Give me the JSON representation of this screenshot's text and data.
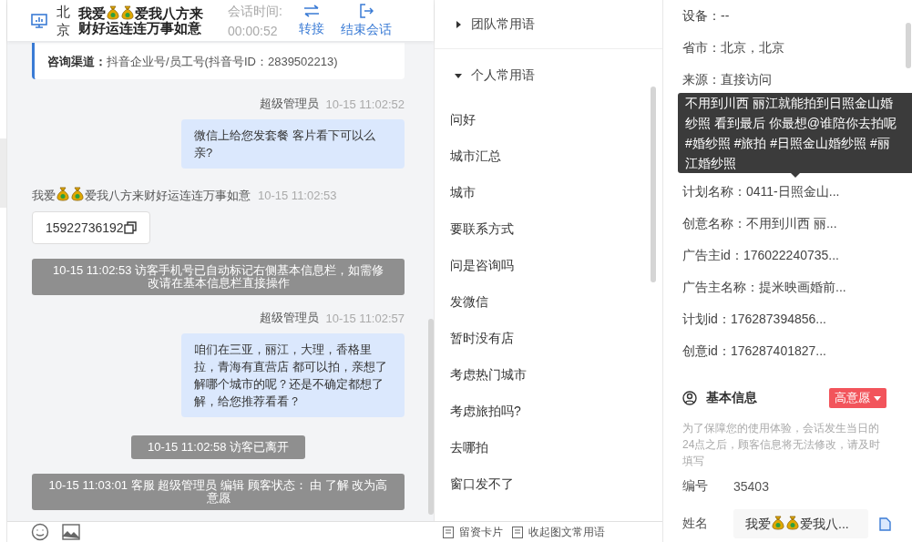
{
  "header": {
    "location": "北京",
    "visitor_name_lines": [
      [
        {
          "kind": "text",
          "text": "我爱"
        },
        {
          "kind": "moneybag"
        },
        {
          "kind": "moneybag"
        },
        {
          "kind": "text",
          "text": "爱我八方来"
        }
      ],
      [
        {
          "kind": "text",
          "text": "财好运连连万事如意"
        }
      ]
    ],
    "session_label": "会话时间:",
    "session_time": "00:00:52",
    "actions": [
      {
        "kind": "transfer",
        "label": "转接"
      },
      {
        "kind": "end",
        "label": "结束会话"
      }
    ]
  },
  "channel_card": {
    "label": "咨询渠道：",
    "value": "抖音企业号/员工号(抖音号ID：2839502213)"
  },
  "messages": [
    {
      "kind": "agent",
      "sender": "超级管理员",
      "time": "10-15 11:02:52",
      "text": "微信上给您发套餐 客片看下可以么亲?"
    },
    {
      "kind": "visitor",
      "sender": [
        {
          "kind": "text",
          "text": "我爱"
        },
        {
          "kind": "moneybag"
        },
        {
          "kind": "moneybag"
        },
        {
          "kind": "text",
          "text": "爱我八方来财好运连连万事如意"
        }
      ],
      "time": "10-15 11:02:53",
      "text": "15922736192"
    },
    {
      "kind": "system",
      "text": "10-15 11:02:53 访客手机号已自动标记右侧基本信息栏，如需修改请在基本信息栏直接操作"
    },
    {
      "kind": "agent",
      "sender": "超级管理员",
      "time": "10-15 11:02:57",
      "text": "咱们在三亚，丽江，大理，香格里拉，青海有直营店 都可以拍，亲想了解哪个城市的呢？还是不确定都想了解，给您推荐看看？"
    },
    {
      "kind": "notice",
      "text": "10-15 11:02:58 访客已离开"
    },
    {
      "kind": "system",
      "text": "10-15 11:03:01 客服 超级管理员 编辑 顾客状态： 由 了解 改为高意愿"
    }
  ],
  "phrases": {
    "groups": [
      {
        "title": "团队常用语",
        "expanded": false
      },
      {
        "title": "个人常用语",
        "expanded": true,
        "items": [
          "问好",
          "城市汇总",
          "城市",
          "要联系方式",
          "问是咨询吗",
          "发微信",
          "暂时没有店",
          "考虑热门城市",
          "考虑旅拍吗?",
          "去哪拍",
          "窗口发不了"
        ]
      }
    ]
  },
  "bottom_actions": [
    {
      "label": "留资卡片"
    },
    {
      "label": "收起图文常用语"
    }
  ],
  "info": {
    "rows": [
      "设备：--",
      "省市：北京，北京",
      "来源：直接访问"
    ],
    "tooltip_lines": [
      "不用到川西 丽江就能拍到日照金山婚",
      "纱照 看到最后 你最想@谁陪你去拍呢",
      "#婚纱照 #旅拍 #日照金山婚纱照 #丽",
      "江婚纱照"
    ],
    "rows_after_tooltip": [
      "计划名称：0411-日照金山...",
      "创意名称：不用到川西 丽...",
      "广告主id：176022240735...",
      "广告主名称：提米映画婚前...",
      "计划id：176287394856...",
      "创意id：176287401827..."
    ]
  },
  "basic_info": {
    "title": "基本信息",
    "intent": "高意愿",
    "note": "为了保障您的使用体验，会话发生当日的24点之后，顾客信息将无法修改，请及时填写",
    "fields": [
      {
        "kind": "text",
        "label": "编号",
        "value": "35403"
      },
      {
        "kind": "name",
        "label": "姓名",
        "value": [
          {
            "kind": "text",
            "text": "我爱"
          },
          {
            "kind": "moneybag"
          },
          {
            "kind": "moneybag"
          },
          {
            "kind": "text",
            "text": "爱我八..."
          }
        ]
      }
    ]
  }
}
